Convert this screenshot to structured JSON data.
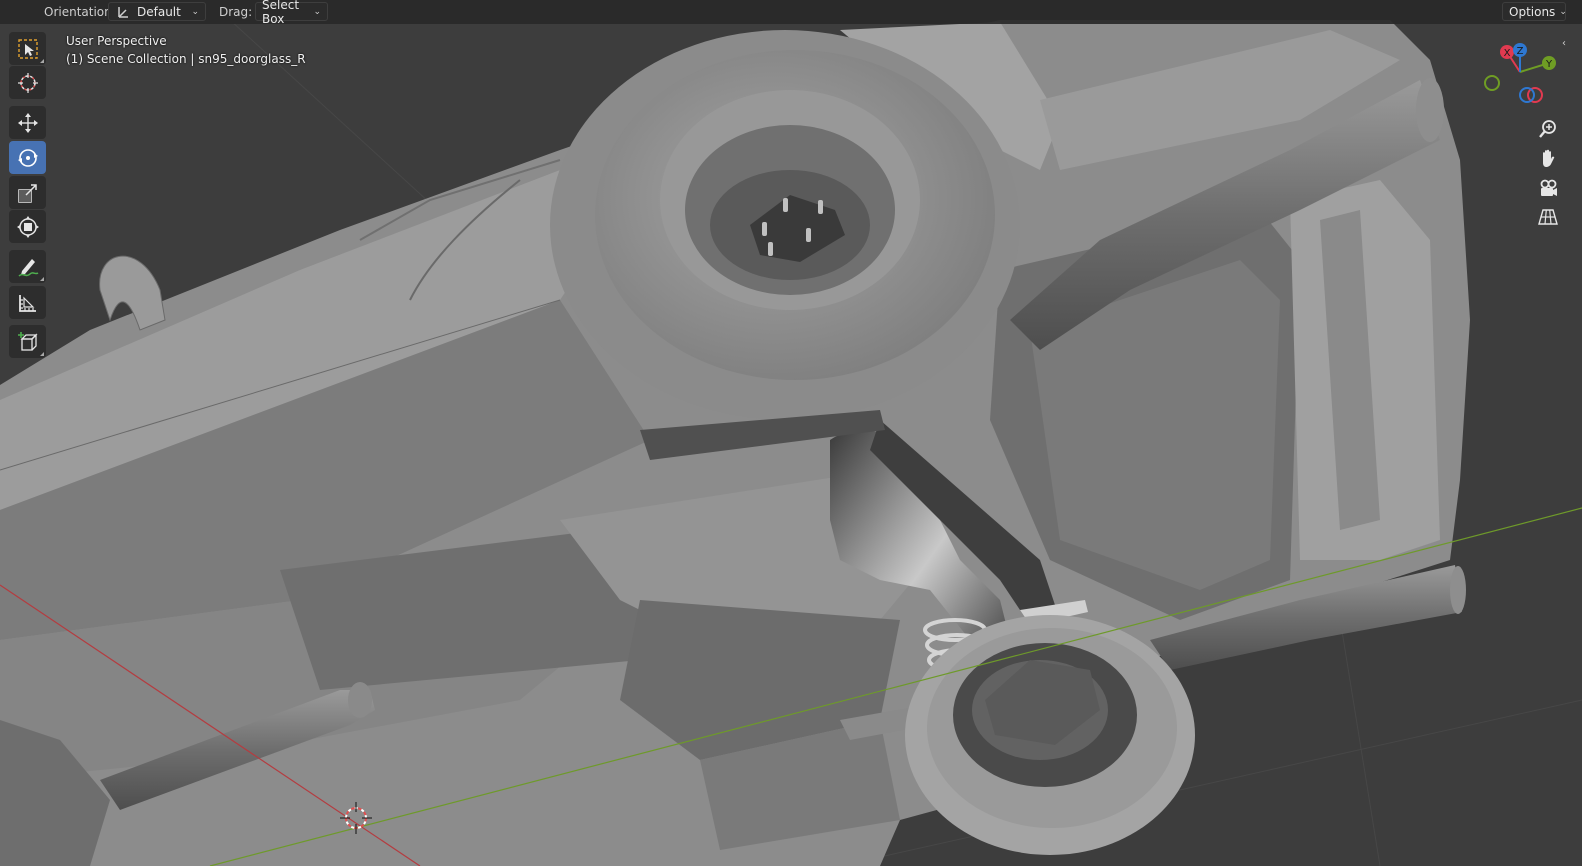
{
  "header": {
    "orientation_label": "Orientation:",
    "orientation_value": "Default",
    "drag_label": "Drag:",
    "drag_value": "Select Box",
    "options_label": "Options"
  },
  "view_info": {
    "perspective": "User Perspective",
    "collection": "(1) Scene Collection | sn95_doorglass_R"
  },
  "toolbar": {
    "tools": [
      {
        "name": "select-box",
        "icon": "select-box-icon",
        "active": false
      },
      {
        "name": "cursor",
        "icon": "cursor-icon",
        "active": false
      },
      {
        "name": "move",
        "icon": "move-icon",
        "active": false
      },
      {
        "name": "rotate",
        "icon": "rotate-icon",
        "active": true
      },
      {
        "name": "scale",
        "icon": "scale-icon",
        "active": false
      },
      {
        "name": "transform",
        "icon": "transform-icon",
        "active": false
      },
      {
        "name": "annotate",
        "icon": "annotate-icon",
        "active": false
      },
      {
        "name": "measure",
        "icon": "measure-icon",
        "active": false
      },
      {
        "name": "add-cube",
        "icon": "add-cube-icon",
        "active": false
      }
    ]
  },
  "gizmo": {
    "axes": {
      "x": "X",
      "y": "Y",
      "z": "Z"
    },
    "colors": {
      "x": "#e13a50",
      "y": "#6f9d24",
      "z": "#2e78d2"
    }
  },
  "navigation": [
    "zoom-icon",
    "pan-hand-icon",
    "camera-icon",
    "grid-view-icon"
  ],
  "viewport": {
    "colors": {
      "background": "#3d3d3d",
      "body": "#8d8d8d",
      "x_axis_line": "#b43c40",
      "y_axis_line": "#6e9a2a"
    }
  }
}
